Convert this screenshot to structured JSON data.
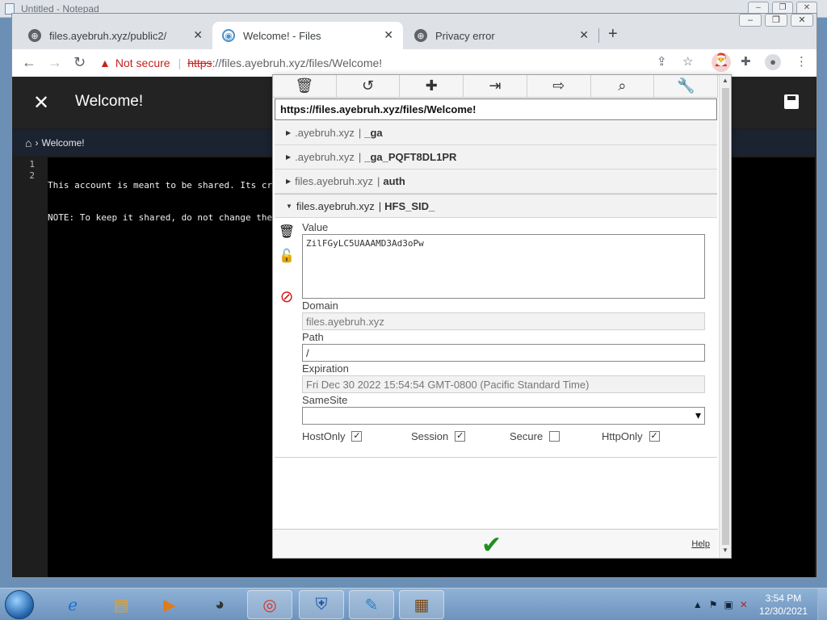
{
  "notepad": {
    "title": "Untitled - Notepad"
  },
  "browser": {
    "tabs": [
      {
        "title": "files.ayebruh.xyz/public2/"
      },
      {
        "title": "Welcome! - Files"
      },
      {
        "title": "Privacy error"
      }
    ],
    "address": {
      "security_label": "Not secure",
      "scheme": "https",
      "rest": "://files.ayebruh.xyz/files/Welcome!"
    }
  },
  "hfs": {
    "title": "Welcome!",
    "breadcrumb": "Welcome!",
    "lines": [
      {
        "num": "1",
        "text": "This account is meant to be shared. Its cre"
      },
      {
        "num": "2",
        "text": "NOTE: To keep it shared, do not change the"
      }
    ]
  },
  "cookie_editor": {
    "url": "https://files.ayebruh.xyz/files/Welcome!",
    "cookies": [
      {
        "domain": ".ayebruh.xyz",
        "sep": "|",
        "name": "_ga"
      },
      {
        "domain": ".ayebruh.xyz",
        "sep": "|",
        "name": "_ga_PQFT8DL1PR"
      },
      {
        "domain": "files.ayebruh.xyz",
        "sep": "|",
        "name": "auth"
      },
      {
        "domain": "files.ayebruh.xyz",
        "sep": "|",
        "name": "HFS_SID_"
      }
    ],
    "detail": {
      "value_label": "Value",
      "value": "ZilFGyLC5UAAAMD3Ad3oPw",
      "domain_label": "Domain",
      "domain": "files.ayebruh.xyz",
      "path_label": "Path",
      "path": "/",
      "expiration_label": "Expiration",
      "expiration": "Fri Dec 30 2022 15:54:54 GMT-0800 (Pacific Standard Time)",
      "samesite_label": "SameSite",
      "samesite": "",
      "flags": [
        {
          "label": "HostOnly",
          "checked": "✓"
        },
        {
          "label": "Session",
          "checked": "✓"
        },
        {
          "label": "Secure",
          "checked": ""
        },
        {
          "label": "HttpOnly",
          "checked": "✓"
        }
      ]
    },
    "help": "Help"
  },
  "taskbar": {
    "time": "3:54 PM",
    "date": "12/30/2021"
  },
  "colors": {
    "accent_green": "#1f8f1f",
    "danger_red": "#c5221f"
  }
}
